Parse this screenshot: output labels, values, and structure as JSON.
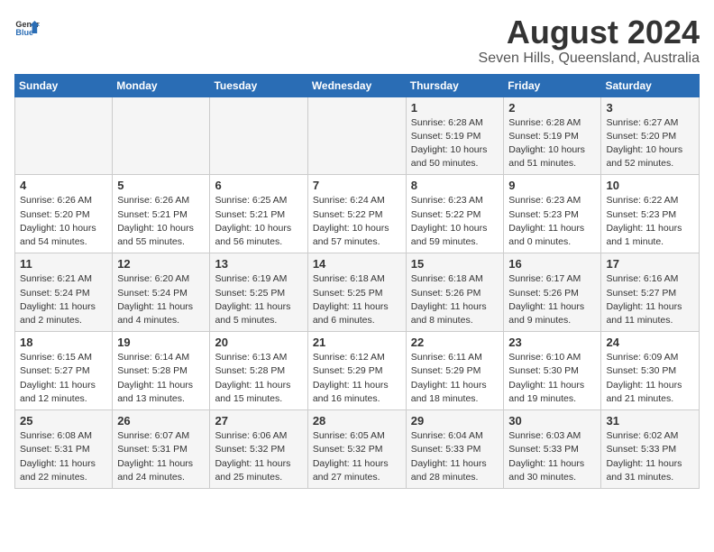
{
  "logo": {
    "text_general": "General",
    "text_blue": "Blue"
  },
  "header": {
    "title": "August 2024",
    "subtitle": "Seven Hills, Queensland, Australia"
  },
  "weekdays": [
    "Sunday",
    "Monday",
    "Tuesday",
    "Wednesday",
    "Thursday",
    "Friday",
    "Saturday"
  ],
  "weeks": [
    [
      {
        "day": "",
        "info": ""
      },
      {
        "day": "",
        "info": ""
      },
      {
        "day": "",
        "info": ""
      },
      {
        "day": "",
        "info": ""
      },
      {
        "day": "1",
        "info": "Sunrise: 6:28 AM\nSunset: 5:19 PM\nDaylight: 10 hours\nand 50 minutes."
      },
      {
        "day": "2",
        "info": "Sunrise: 6:28 AM\nSunset: 5:19 PM\nDaylight: 10 hours\nand 51 minutes."
      },
      {
        "day": "3",
        "info": "Sunrise: 6:27 AM\nSunset: 5:20 PM\nDaylight: 10 hours\nand 52 minutes."
      }
    ],
    [
      {
        "day": "4",
        "info": "Sunrise: 6:26 AM\nSunset: 5:20 PM\nDaylight: 10 hours\nand 54 minutes."
      },
      {
        "day": "5",
        "info": "Sunrise: 6:26 AM\nSunset: 5:21 PM\nDaylight: 10 hours\nand 55 minutes."
      },
      {
        "day": "6",
        "info": "Sunrise: 6:25 AM\nSunset: 5:21 PM\nDaylight: 10 hours\nand 56 minutes."
      },
      {
        "day": "7",
        "info": "Sunrise: 6:24 AM\nSunset: 5:22 PM\nDaylight: 10 hours\nand 57 minutes."
      },
      {
        "day": "8",
        "info": "Sunrise: 6:23 AM\nSunset: 5:22 PM\nDaylight: 10 hours\nand 59 minutes."
      },
      {
        "day": "9",
        "info": "Sunrise: 6:23 AM\nSunset: 5:23 PM\nDaylight: 11 hours\nand 0 minutes."
      },
      {
        "day": "10",
        "info": "Sunrise: 6:22 AM\nSunset: 5:23 PM\nDaylight: 11 hours\nand 1 minute."
      }
    ],
    [
      {
        "day": "11",
        "info": "Sunrise: 6:21 AM\nSunset: 5:24 PM\nDaylight: 11 hours\nand 2 minutes."
      },
      {
        "day": "12",
        "info": "Sunrise: 6:20 AM\nSunset: 5:24 PM\nDaylight: 11 hours\nand 4 minutes."
      },
      {
        "day": "13",
        "info": "Sunrise: 6:19 AM\nSunset: 5:25 PM\nDaylight: 11 hours\nand 5 minutes."
      },
      {
        "day": "14",
        "info": "Sunrise: 6:18 AM\nSunset: 5:25 PM\nDaylight: 11 hours\nand 6 minutes."
      },
      {
        "day": "15",
        "info": "Sunrise: 6:18 AM\nSunset: 5:26 PM\nDaylight: 11 hours\nand 8 minutes."
      },
      {
        "day": "16",
        "info": "Sunrise: 6:17 AM\nSunset: 5:26 PM\nDaylight: 11 hours\nand 9 minutes."
      },
      {
        "day": "17",
        "info": "Sunrise: 6:16 AM\nSunset: 5:27 PM\nDaylight: 11 hours\nand 11 minutes."
      }
    ],
    [
      {
        "day": "18",
        "info": "Sunrise: 6:15 AM\nSunset: 5:27 PM\nDaylight: 11 hours\nand 12 minutes."
      },
      {
        "day": "19",
        "info": "Sunrise: 6:14 AM\nSunset: 5:28 PM\nDaylight: 11 hours\nand 13 minutes."
      },
      {
        "day": "20",
        "info": "Sunrise: 6:13 AM\nSunset: 5:28 PM\nDaylight: 11 hours\nand 15 minutes."
      },
      {
        "day": "21",
        "info": "Sunrise: 6:12 AM\nSunset: 5:29 PM\nDaylight: 11 hours\nand 16 minutes."
      },
      {
        "day": "22",
        "info": "Sunrise: 6:11 AM\nSunset: 5:29 PM\nDaylight: 11 hours\nand 18 minutes."
      },
      {
        "day": "23",
        "info": "Sunrise: 6:10 AM\nSunset: 5:30 PM\nDaylight: 11 hours\nand 19 minutes."
      },
      {
        "day": "24",
        "info": "Sunrise: 6:09 AM\nSunset: 5:30 PM\nDaylight: 11 hours\nand 21 minutes."
      }
    ],
    [
      {
        "day": "25",
        "info": "Sunrise: 6:08 AM\nSunset: 5:31 PM\nDaylight: 11 hours\nand 22 minutes."
      },
      {
        "day": "26",
        "info": "Sunrise: 6:07 AM\nSunset: 5:31 PM\nDaylight: 11 hours\nand 24 minutes."
      },
      {
        "day": "27",
        "info": "Sunrise: 6:06 AM\nSunset: 5:32 PM\nDaylight: 11 hours\nand 25 minutes."
      },
      {
        "day": "28",
        "info": "Sunrise: 6:05 AM\nSunset: 5:32 PM\nDaylight: 11 hours\nand 27 minutes."
      },
      {
        "day": "29",
        "info": "Sunrise: 6:04 AM\nSunset: 5:33 PM\nDaylight: 11 hours\nand 28 minutes."
      },
      {
        "day": "30",
        "info": "Sunrise: 6:03 AM\nSunset: 5:33 PM\nDaylight: 11 hours\nand 30 minutes."
      },
      {
        "day": "31",
        "info": "Sunrise: 6:02 AM\nSunset: 5:33 PM\nDaylight: 11 hours\nand 31 minutes."
      }
    ]
  ]
}
